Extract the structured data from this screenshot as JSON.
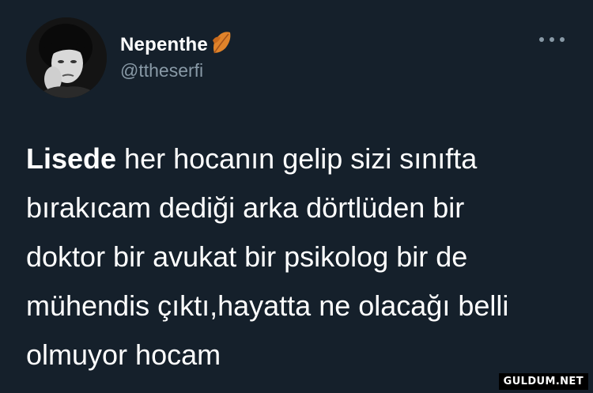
{
  "tweet": {
    "author": {
      "display_name": "Nepenthe",
      "handle": "@ttheserfi",
      "name_emoji_icon": "fallen-leaf-icon"
    },
    "menu_icon": "more-horizontal-icon",
    "text_lines": [
      {
        "bold": "Lisede",
        "rest": " her hocanın gelip sizi sınıfta"
      },
      {
        "bold": "",
        "rest": "bırakıcam dediği arka dörtlüden bir"
      },
      {
        "bold": "",
        "rest": "doktor bir avukat bir psikolog bir de"
      },
      {
        "bold": "",
        "rest": "mühendis çıktı,hayatta ne olacağı belli"
      },
      {
        "bold": "",
        "rest": "olmuyor hocam"
      }
    ]
  },
  "watermark": "GULDUM.NET",
  "colors": {
    "background": "#15202b",
    "text": "#ffffff",
    "secondary_text": "#8899a6",
    "leaf_orange": "#e0832a"
  }
}
